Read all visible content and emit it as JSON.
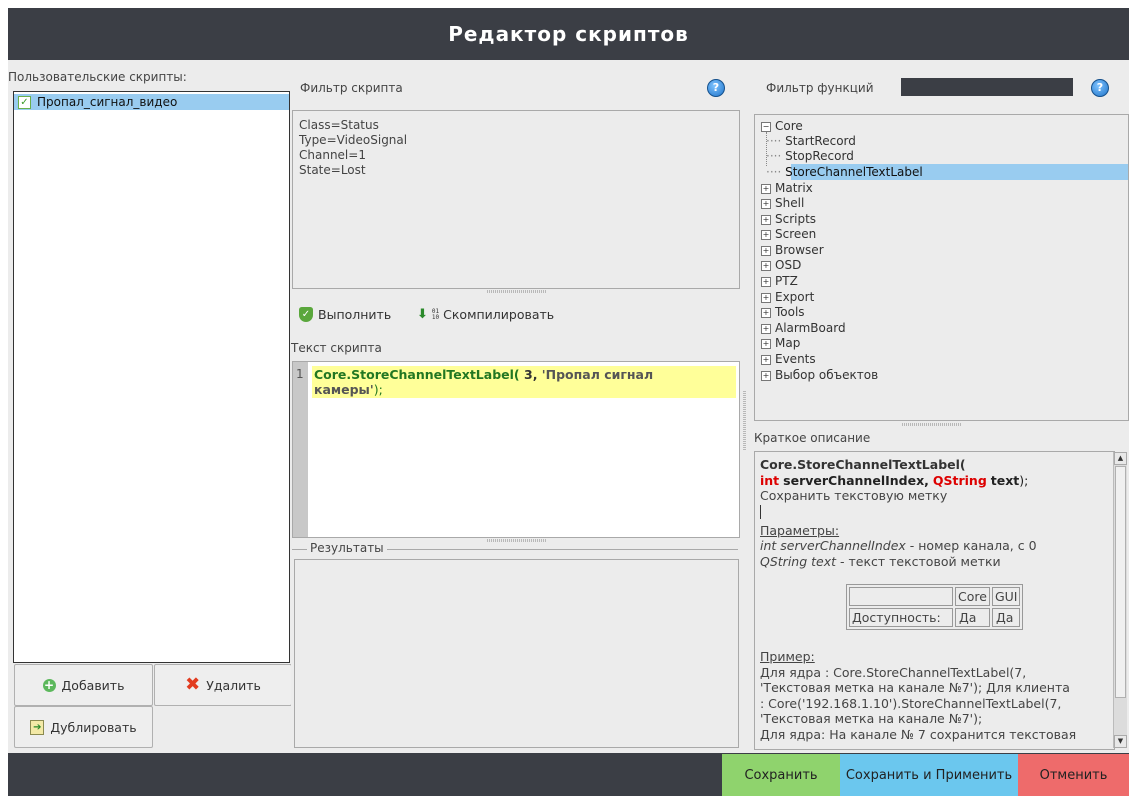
{
  "window": {
    "title": "Редактор скриптов"
  },
  "scripts_panel": {
    "label": "Пользовательские скрипты:",
    "items": [
      {
        "label": "Пропал_сигнал_видео",
        "checked": true,
        "selected": true
      }
    ],
    "buttons": {
      "add": "Добавить",
      "delete": "Удалить",
      "duplicate": "Дублировать"
    }
  },
  "script_filter": {
    "label": "Фильтр скрипта",
    "lines": [
      "Class=Status",
      "Type=VideoSignal",
      "Channel=1",
      "State=Lost"
    ]
  },
  "toolbar": {
    "run_label": "Выполнить",
    "compile_label": "Скомпилировать"
  },
  "script_text": {
    "label": "Текст скрипта",
    "line_number": "1",
    "func": "Core.StoreChannelTextLabel(",
    "arg1": " 3,",
    "arg2_part1": " 'Пропал сигнал",
    "arg2_part2": "камеры'",
    "tail": ");"
  },
  "results": {
    "label": "Результаты"
  },
  "function_filter": {
    "label": "Фильтр функций",
    "value": ""
  },
  "function_tree": {
    "root": "Core",
    "children": [
      "StartRecord",
      "StopRecord",
      "StoreChannelTextLabel"
    ],
    "selected": "StoreChannelTextLabel",
    "groups": [
      "Matrix",
      "Shell",
      "Scripts",
      "Screen",
      "Browser",
      "OSD",
      "PTZ",
      "Export",
      "Tools",
      "AlarmBoard",
      "Map",
      "Events",
      "Выбор объектов"
    ]
  },
  "description": {
    "label": "Краткое описание",
    "signature_name": "Core.StoreChannelTextLabel(",
    "param1_type": "int",
    "param1_name": "serverChannelIndex,",
    "param2_type": "QString",
    "param2_name": "text",
    "signature_close": ");",
    "summary": "Сохранить текстовую метку",
    "params_heading": "Параметры:",
    "param1_doc_sig": "int serverChannelIndex",
    "param1_doc": " - номер канала, с 0",
    "param2_doc_sig": "QString text",
    "param2_doc": " - текст текстовой метки",
    "table": {
      "headers": [
        "",
        "Core",
        "GUI"
      ],
      "row_label": "Доступность:",
      "row_values": [
        "Да",
        "Да"
      ]
    },
    "example_heading": "Пример:",
    "example_line1": "Для ядра : Core.StoreChannelTextLabel(7,",
    "example_line2": "'Текстовая метка на канале №7'); Для клиента",
    "example_line3": ": Core('192.168.1.10').StoreChannelTextLabel(7,",
    "example_line4": "'Текстовая метка на канале №7');",
    "example_line5": "Для ядра: На канале № 7 сохранится текстовая"
  },
  "footer": {
    "save": "Сохранить",
    "save_apply": "Сохранить и Применить",
    "cancel": "Отменить"
  },
  "colors": {
    "save": "#8fd36d",
    "save_apply": "#6bc7ee",
    "cancel": "#ee6b6b",
    "selection": "#99ccf0",
    "highlight_line": "#ffff99",
    "keyword_green": "#227722",
    "keyword_red": "#dd0000"
  }
}
